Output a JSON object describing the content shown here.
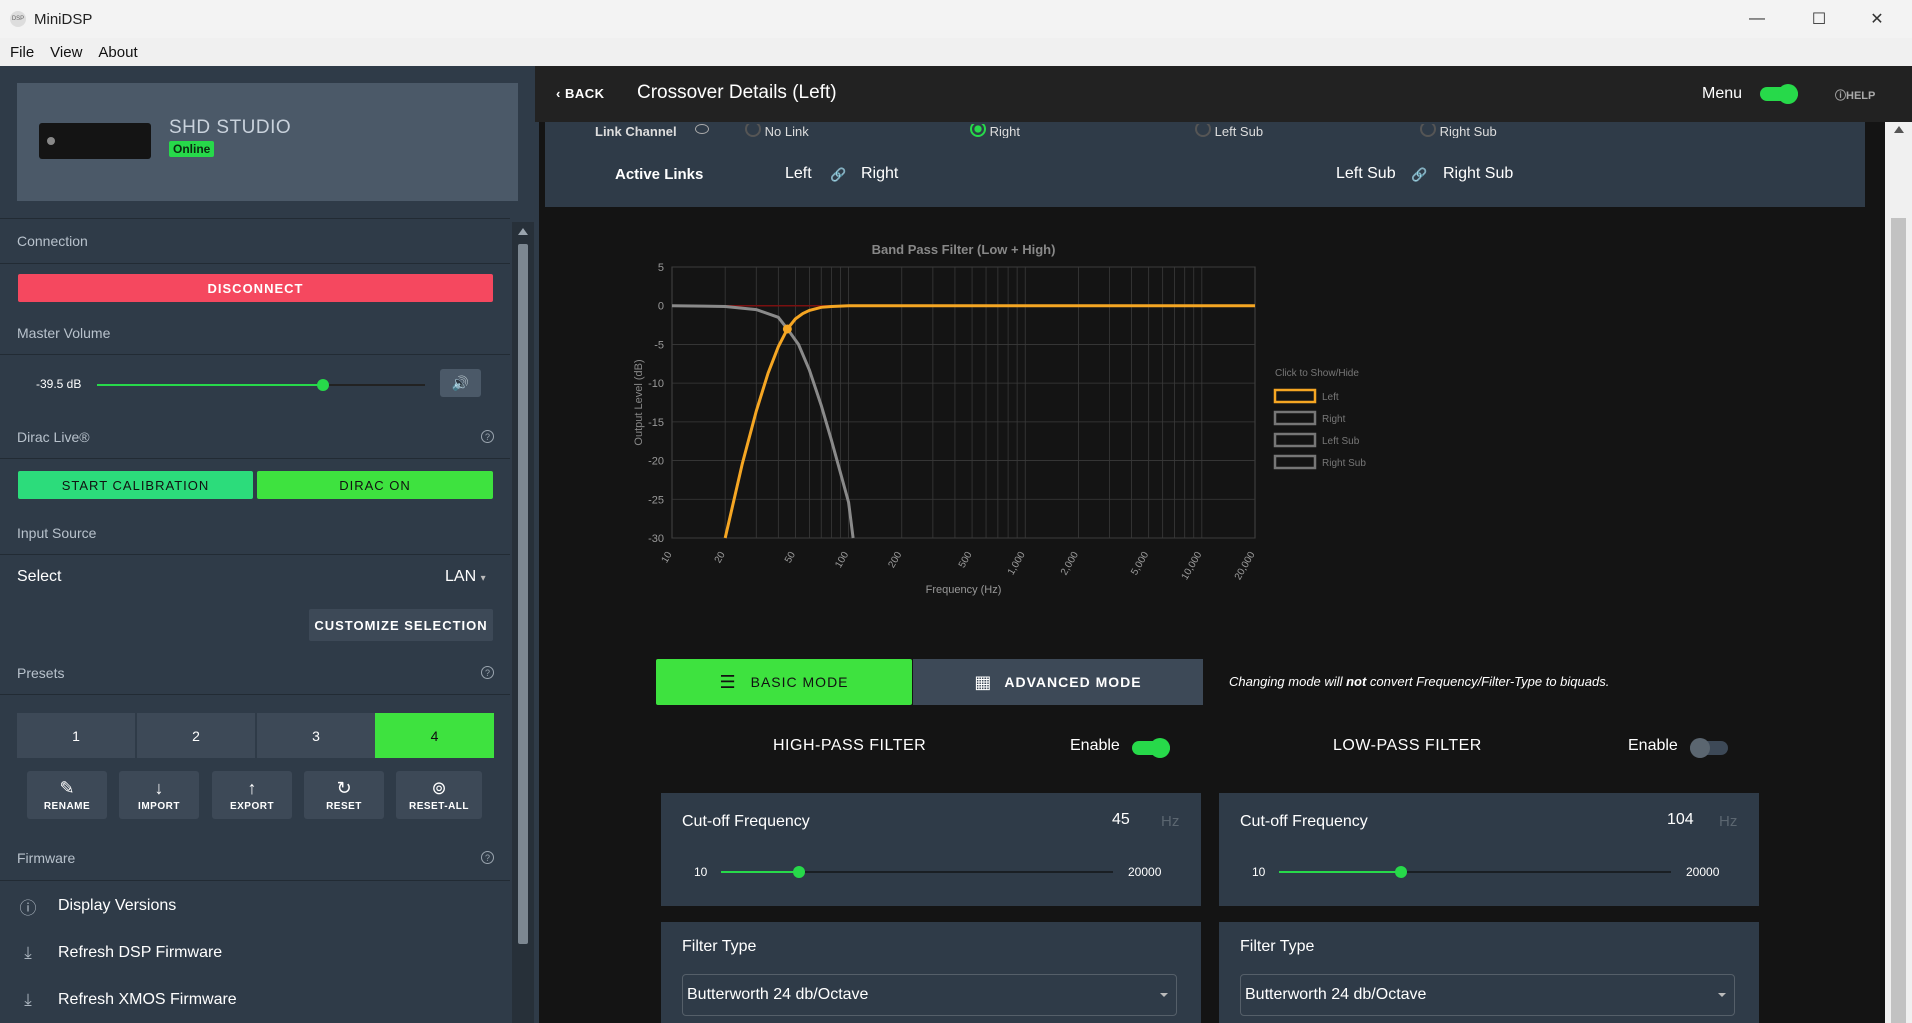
{
  "window": {
    "title": "MiniDSP",
    "app_icon": "DSP",
    "controls": [
      "minimize",
      "maximize",
      "close"
    ]
  },
  "menubar": [
    "File",
    "View",
    "About"
  ],
  "sidebar": {
    "device": {
      "name": "SHD STUDIO",
      "status": "Online"
    },
    "connection": {
      "title": "Connection",
      "disconnect": "DISCONNECT"
    },
    "master_volume": {
      "title": "Master Volume",
      "value": "-39.5 dB",
      "level": 0.69
    },
    "dirac": {
      "title": "Dirac Live®",
      "start": "START CALIBRATION",
      "on": "DIRAC ON"
    },
    "input_source": {
      "title": "Input Source",
      "select_label": "Select",
      "value": "LAN",
      "customize": "CUSTOMIZE SELECTION"
    },
    "presets": {
      "title": "Presets",
      "items": [
        "1",
        "2",
        "3",
        "4"
      ],
      "active": "4",
      "actions": [
        {
          "label": "RENAME",
          "icon": "edit-icon",
          "glyph": "✎"
        },
        {
          "label": "IMPORT",
          "icon": "import-icon",
          "glyph": "↓"
        },
        {
          "label": "EXPORT",
          "icon": "export-icon",
          "glyph": "↑"
        },
        {
          "label": "RESET",
          "icon": "reset-icon",
          "glyph": "↻"
        },
        {
          "label": "RESET-ALL",
          "icon": "reset-all-icon",
          "glyph": "⊚"
        }
      ]
    },
    "firmware": {
      "title": "Firmware",
      "items": [
        {
          "label": "Display Versions",
          "icon": "info-icon",
          "glyph": "ⓘ"
        },
        {
          "label": "Refresh DSP Firmware",
          "icon": "download-icon",
          "glyph": "⤓"
        },
        {
          "label": "Refresh XMOS Firmware",
          "icon": "download-icon",
          "glyph": "⤓"
        }
      ]
    }
  },
  "header": {
    "back": "BACK",
    "title": "Crossover Details (Left)",
    "menu_label": "Menu",
    "menu_on": true,
    "help": "HELP"
  },
  "links": {
    "link_channel_label": "Link Channel",
    "options": [
      {
        "label": "No Link",
        "selected": false
      },
      {
        "label": "Right",
        "selected": true
      },
      {
        "label": "Left Sub",
        "selected": false
      },
      {
        "label": "Right Sub",
        "selected": false
      }
    ],
    "active_links_label": "Active Links",
    "active_links": [
      {
        "a": "Left",
        "b": "Right"
      },
      {
        "a": "Left Sub",
        "b": "Right Sub"
      }
    ]
  },
  "chart_data": {
    "type": "line",
    "title": "Band Pass Filter (Low + High)",
    "xlabel": "Frequency (Hz)",
    "ylabel": "Output Level (dB)",
    "xscale": "log",
    "xlim": [
      10,
      20000
    ],
    "ylim": [
      -30,
      5
    ],
    "x_ticks": [
      "10",
      "20",
      "50",
      "100",
      "200",
      "500",
      "1,000",
      "2,000",
      "5,000",
      "10,000",
      "20,000"
    ],
    "x_tick_values": [
      10,
      20,
      50,
      100,
      200,
      500,
      1000,
      2000,
      5000,
      10000,
      20000
    ],
    "y_ticks": [
      5,
      0,
      -5,
      -10,
      -15,
      -20,
      -25,
      -30
    ],
    "grid": true,
    "legend_title": "Click to Show/Hide",
    "legend_position": "right",
    "series": [
      {
        "name": "Left",
        "color": "#f5a623",
        "visible": true,
        "x": [
          20,
          25,
          30,
          35,
          40,
          45,
          50,
          55,
          60,
          70,
          80,
          100,
          200,
          1000,
          20000
        ],
        "y": [
          -30,
          -20.4,
          -13.6,
          -8.7,
          -5.3,
          -3.0,
          -1.7,
          -1.0,
          -0.6,
          -0.2,
          -0.1,
          0,
          0,
          0,
          0
        ]
      },
      {
        "name": "Right",
        "color": "#8a8a8a",
        "visible": true,
        "x": [
          10,
          15,
          20,
          30,
          40,
          45,
          52,
          60,
          70,
          80,
          90,
          100,
          106
        ],
        "y": [
          0,
          -0.05,
          -0.1,
          -0.5,
          -1.5,
          -3.0,
          -5.0,
          -8.3,
          -12.9,
          -17.4,
          -21.6,
          -25.4,
          -30
        ]
      },
      {
        "name": "Left Sub",
        "color": "#8a8a8a",
        "visible": false
      },
      {
        "name": "Right Sub",
        "color": "#8a8a8a",
        "visible": false
      }
    ],
    "annotations": [
      {
        "type": "point",
        "x": 45,
        "y": -3.0
      }
    ]
  },
  "modes": {
    "basic": "BASIC MODE",
    "advanced": "ADVANCED MODE",
    "active": "basic",
    "note_pre": "Changing mode will ",
    "note_bold": "not",
    "note_post": " convert Frequency/Filter-Type to biquads."
  },
  "high_pass": {
    "title": "HIGH-PASS FILTER",
    "enable_label": "Enable",
    "enabled": true,
    "cutoff_label": "Cut-off Frequency",
    "cutoff": "45",
    "unit": "Hz",
    "min": "10",
    "max": "20000",
    "slider_pos": 0.2,
    "filter_type_label": "Filter Type",
    "filter_type": "Butterworth 24 db/Octave"
  },
  "low_pass": {
    "title": "LOW-PASS FILTER",
    "enable_label": "Enable",
    "enabled": false,
    "cutoff_label": "Cut-off Frequency",
    "cutoff": "104",
    "unit": "Hz",
    "min": "10",
    "max": "20000",
    "slider_pos": 0.31,
    "filter_type_label": "Filter Type",
    "filter_type": "Butterworth 24 db/Octave"
  },
  "colors": {
    "accent": "#27d94a",
    "danger": "#f5485f",
    "panel": "#2f3b48",
    "left_curve": "#f5a623"
  }
}
